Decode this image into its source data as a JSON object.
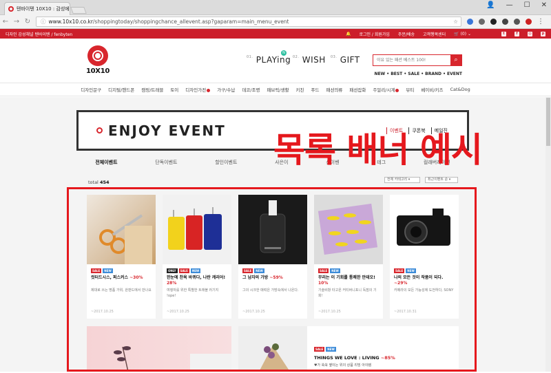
{
  "browser": {
    "tab_title": "텐바이텐 10X10 : 감성에",
    "url_domain": "www.10x10.co.kr",
    "url_path": "/shoppingtoday/shoppingchance_allevent.asp?gaparam=main_menu_event"
  },
  "topbar": {
    "tagline": "디자인 감성채널 텐바이텐 / fenbyten",
    "links": [
      "로그인 / 회원가입",
      "주문/배송",
      "고객행복센터"
    ],
    "cart": "(0)"
  },
  "header": {
    "logo_text": "10X10",
    "picks": [
      {
        "num": "01.",
        "label": "PLAYing",
        "badge": "N"
      },
      {
        "num": "02.",
        "label": "WISH"
      },
      {
        "num": "03.",
        "label": "GIFT"
      }
    ],
    "search_placeholder": "이유 있는 패션 베스트 100!",
    "quick_links": "NEW • BEST • SALE • BRAND • EVENT"
  },
  "categories": [
    "디자인문구",
    "디지털/핸드폰",
    "캠핑/트래블",
    "토이",
    "디자인가전",
    "가구/수납",
    "데코/조명",
    "패브릭/생활",
    "키친",
    "푸드",
    "패션의류",
    "패션잡화",
    "주얼리/시계",
    "뷰티",
    "베이비/키즈",
    "Cat&Dog"
  ],
  "hero": {
    "title": "ENJOY EVENT",
    "links": [
      "이벤트",
      "쿠폰북",
      "메일진"
    ]
  },
  "event_tabs": [
    "전체이벤트",
    "단독이벤트",
    "할인이벤트",
    "사은이",
    "신이벤",
    "테그",
    "컬래버레이션"
  ],
  "overlay_text": "목록 배너 예시",
  "list": {
    "total_label": "total",
    "total_count": "454",
    "filter_category": "전체 카테고리",
    "filter_sort": "최근이벤트 순"
  },
  "cards": [
    {
      "tags": [
        "SALE",
        "NEW"
      ],
      "title": "컷터드시스, 퍼스커스",
      "pct": "~30%",
      "desc": "제대로 쓰는 명품 가위, 완판드에서 만나요",
      "date": "~2017.10.25"
    },
    {
      "tags": [
        "ONLY",
        "SALE",
        "NEW"
      ],
      "title": "한눈에 찬욕 바뀌다, 나란 캐리어!",
      "pct": "28%",
      "desc": "여행자를 위한 특별한 트래블 러기지 !ope!",
      "date": "~2017.10.25"
    },
    {
      "tags": [
        "SALE",
        "NEW"
      ],
      "title": "그 남자의 가방",
      "pct": "~59%",
      "desc": "그의 시크한 매력은 가방속에서 나온다.",
      "date": "~2017.10.25"
    },
    {
      "tags": [
        "SALE",
        "NEW"
      ],
      "title": "무리는 이 기회를 통쾌한 안테오!",
      "pct": "10%",
      "desc": "기술비항 타고온 커티버니포니 독점의 기회!",
      "date": "~2017.10.25"
    },
    {
      "tags": [
        "SALE",
        "NEW"
      ],
      "title": "나의 모든 것이 작품이 되다.",
      "pct": "~29%",
      "desc": "카메라의 모든 가능성에 도전하다, SONY",
      "date": "~2017.10.31"
    }
  ],
  "feature_card": {
    "tags": [
      "SALE",
      "NEW"
    ],
    "title": "THINGS WE LOVE : LIVING",
    "pct": "~85%",
    "desc": "♥가 쑥쑥 옆이는 위의 상품 리빙 아이템"
  }
}
